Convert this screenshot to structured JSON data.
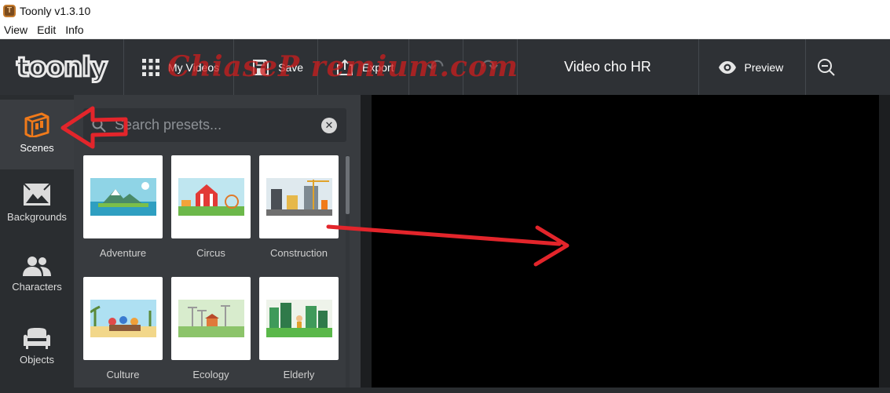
{
  "window": {
    "title": "Toonly v1.3.10"
  },
  "menu": [
    "View",
    "Edit",
    "Info"
  ],
  "toolbar": {
    "logo": "toonly",
    "my_videos": "My Videos",
    "save": "Save",
    "export": "Export",
    "video_title": "Video cho HR",
    "preview": "Preview"
  },
  "watermark": "ChiaseP remium.com",
  "nav": [
    {
      "label": "Scenes",
      "icon": "scenes-icon",
      "active": true
    },
    {
      "label": "Backgrounds",
      "icon": "backgrounds-icon"
    },
    {
      "label": "Characters",
      "icon": "characters-icon"
    },
    {
      "label": "Objects",
      "icon": "objects-icon"
    }
  ],
  "search": {
    "placeholder": "Search presets..."
  },
  "presets": [
    {
      "label": "Adventure"
    },
    {
      "label": "Circus"
    },
    {
      "label": "Construction"
    },
    {
      "label": "Culture"
    },
    {
      "label": "Ecology"
    },
    {
      "label": "Elderly"
    }
  ],
  "colors": {
    "accent": "#f07a1a",
    "toolbar_bg": "#2e3135",
    "annotation": "#e3252b"
  }
}
